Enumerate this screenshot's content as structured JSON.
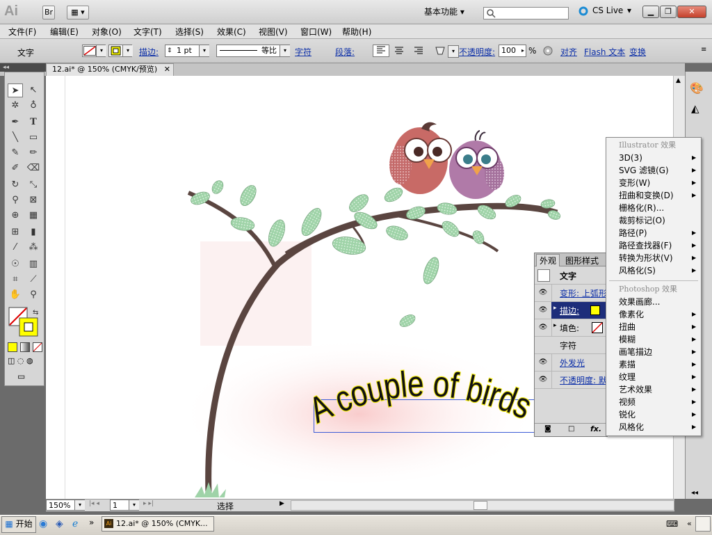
{
  "app": {
    "logo": "Ai",
    "br_badge": "Br",
    "workspace": "基本功能",
    "cs_live": "CS Live"
  },
  "menu": [
    "文件(F)",
    "编辑(E)",
    "对象(O)",
    "文字(T)",
    "选择(S)",
    "效果(C)",
    "视图(V)",
    "窗口(W)",
    "帮助(H)"
  ],
  "control": {
    "tool_label": "文字",
    "stroke_label": "描边:",
    "stroke_weight": "1 pt",
    "stroke_profile": "等比",
    "char_link": "字符",
    "para_label": "段落:",
    "opacity_label": "不透明度:",
    "opacity_value": "100",
    "percent": "%",
    "align_link": "对齐",
    "flash_link": "Flash 文本",
    "transform_link": "变换"
  },
  "document": {
    "tab": "12.ai* @ 150% (CMYK/预览)"
  },
  "status": {
    "zoom": "150%",
    "page": "1",
    "status_text": "选择"
  },
  "canvas": {
    "headline": "A couple of birds"
  },
  "appearance": {
    "tab_appearance": "外观",
    "tab_graphic_styles": "图形样式",
    "object_type": "文字",
    "rows": [
      {
        "label": "变形: 上弧形",
        "link": true
      },
      {
        "label": "描边:",
        "link": true
      },
      {
        "label": "填色:",
        "link": false
      },
      {
        "label": "字符",
        "link": false
      },
      {
        "label": "外发光",
        "link": true
      },
      {
        "label": "不透明度: 默",
        "link": true
      }
    ]
  },
  "context_menu": {
    "illustrator_header": "Illustrator 效果",
    "illustrator_items": [
      "3D(3)",
      "SVG 滤镜(G)",
      "变形(W)",
      "扭曲和变换(D)",
      "栅格化(R)...",
      "裁剪标记(O)",
      "路径(P)",
      "路径查找器(F)",
      "转换为形状(V)",
      "风格化(S)"
    ],
    "photoshop_header": "Photoshop 效果",
    "photoshop_items": [
      "效果画廊...",
      "像素化",
      "扭曲",
      "模糊",
      "画笔描边",
      "素描",
      "纹理",
      "艺术效果",
      "视频",
      "锐化",
      "风格化"
    ]
  },
  "taskbar": {
    "start": "开始",
    "task": "12.ai* @ 150% (CMYK..."
  },
  "colors": {
    "selection": "#3b5bd6",
    "link": "#0b2ea8",
    "fill_yellow": "#ffff00",
    "text_yellow": "#f4ec14"
  }
}
